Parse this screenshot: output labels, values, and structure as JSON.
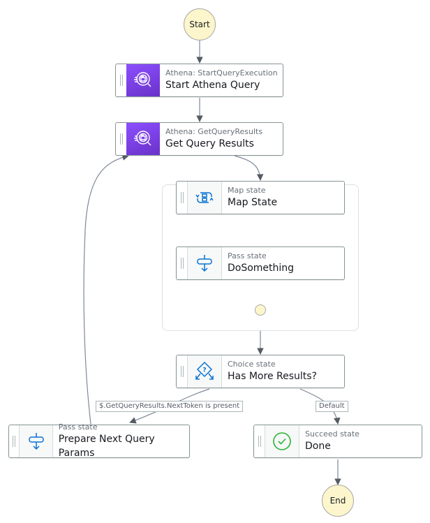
{
  "diagram": {
    "type": "AWS Step Functions workflow",
    "terminals": {
      "start": "Start",
      "end": "End"
    },
    "states": [
      {
        "id": "start_athena",
        "type_label": "Athena: StartQueryExecution",
        "name": "Start Athena Query",
        "icon": "athena-icon",
        "color": "#8c4fff"
      },
      {
        "id": "get_results",
        "type_label": "Athena: GetQueryResults",
        "name": "Get Query Results",
        "icon": "athena-icon",
        "color": "#8c4fff"
      },
      {
        "id": "map_state",
        "type_label": "Map state",
        "name": "Map State",
        "icon": "map-state-icon",
        "color": "#0972d3"
      },
      {
        "id": "do_something",
        "type_label": "Pass state",
        "name": "DoSomething",
        "icon": "pass-state-icon",
        "color": "#0972d3"
      },
      {
        "id": "has_more",
        "type_label": "Choice state",
        "name": "Has More Results?",
        "icon": "choice-state-icon",
        "color": "#0972d3"
      },
      {
        "id": "prepare_next",
        "type_label": "Pass state",
        "name": "Prepare Next Query Params",
        "icon": "pass-state-icon",
        "color": "#0972d3"
      },
      {
        "id": "done",
        "type_label": "Succeed state",
        "name": "Done",
        "icon": "succeed-state-icon",
        "color": "#1d8102"
      }
    ],
    "edges": [
      {
        "from": "Start",
        "to": "Start Athena Query"
      },
      {
        "from": "Start Athena Query",
        "to": "Get Query Results"
      },
      {
        "from": "Get Query Results",
        "to": "Map State"
      },
      {
        "from": "Map State",
        "to": "DoSomething",
        "style": "dashed"
      },
      {
        "from": "DoSomething",
        "to": "map-end"
      },
      {
        "from": "Map State group",
        "to": "Has More Results?"
      },
      {
        "from": "Has More Results?",
        "to": "Prepare Next Query Params",
        "label": "$.GetQueryResults.NextToken is present"
      },
      {
        "from": "Has More Results?",
        "to": "Done",
        "label": "Default"
      },
      {
        "from": "Prepare Next Query Params",
        "to": "Get Query Results"
      },
      {
        "from": "Done",
        "to": "End"
      }
    ],
    "edge_labels": {
      "next_token": "$.GetQueryResults.NextToken is present",
      "default": "Default"
    }
  }
}
